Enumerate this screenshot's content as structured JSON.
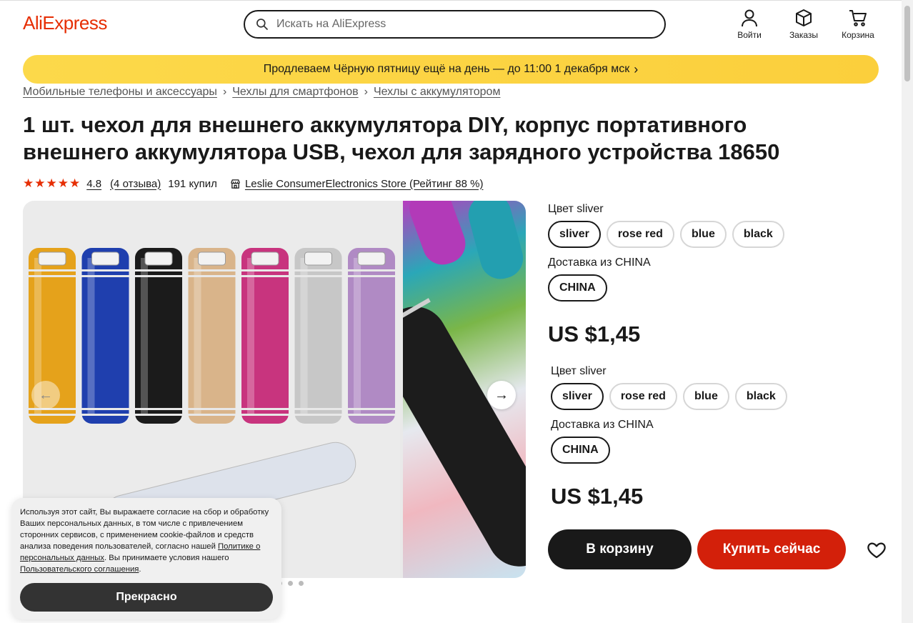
{
  "header": {
    "logo": "AliExpress",
    "search_placeholder": "Искать на AliExpress",
    "login_label": "Войти",
    "orders_label": "Заказы",
    "cart_label": "Корзина"
  },
  "promo": {
    "text": "Продлеваем Чёрную пятницу ещё на день — до 11:00 1 декабря мск"
  },
  "breadcrumb": [
    "Мобильные телефоны и аксессуары",
    "Чехлы для смартфонов",
    "Чехлы с аккумулятором"
  ],
  "product": {
    "title": "1 шт. чехол для внешнего аккумулятора DIY, корпус портативного внешнего аккумулятора USB, чехол для зарядного устройства 18650",
    "stars": 5,
    "rating": "4.8",
    "reviews": "(4 отзыва)",
    "sold": "191 купил",
    "store": "Leslie ConsumerElectronics Store (Рейтинг 88 %)"
  },
  "options": [
    {
      "color_label": "Цвет sliver",
      "colors": [
        "sliver",
        "rose red",
        "blue",
        "black"
      ],
      "selected_color": "sliver",
      "ship_label": "Доставка из CHINA",
      "ship_from": [
        "CHINA"
      ],
      "price": "US $1,45"
    },
    {
      "color_label": "Цвет sliver",
      "colors": [
        "sliver",
        "rose red",
        "blue",
        "black"
      ],
      "selected_color": "sliver",
      "ship_label": "Доставка из CHINA",
      "ship_from": [
        "CHINA"
      ],
      "price": "US $1,45"
    }
  ],
  "actions": {
    "cart": "В корзину",
    "buy": "Купить сейчас"
  },
  "cookie": {
    "text_1": "Используя этот сайт, Вы выражаете согласие на сбор и обработку Ваших персональных данных, в том числе с привлечением сторонних сервисов, с применением cookie-файлов и средств анализа поведения пользователей, согласно нашей ",
    "link_1": "Политике о персональных данных",
    "text_2": ". Вы принимаете условия нашего ",
    "link_2": "Пользовательского соглашения",
    "text_3": ".",
    "button": "Прекрасно"
  },
  "gallery": {
    "tube_colors": [
      "#e5a21b",
      "#1f3fae",
      "#1b1b1b",
      "#d9b48a",
      "#c8347e",
      "#c7c7c7",
      "#b08ac4"
    ],
    "dots": 3
  },
  "colors": {
    "brand_red": "#e62e04",
    "buy_red": "#d3200a",
    "promo_yellow": "#fcd34d"
  }
}
